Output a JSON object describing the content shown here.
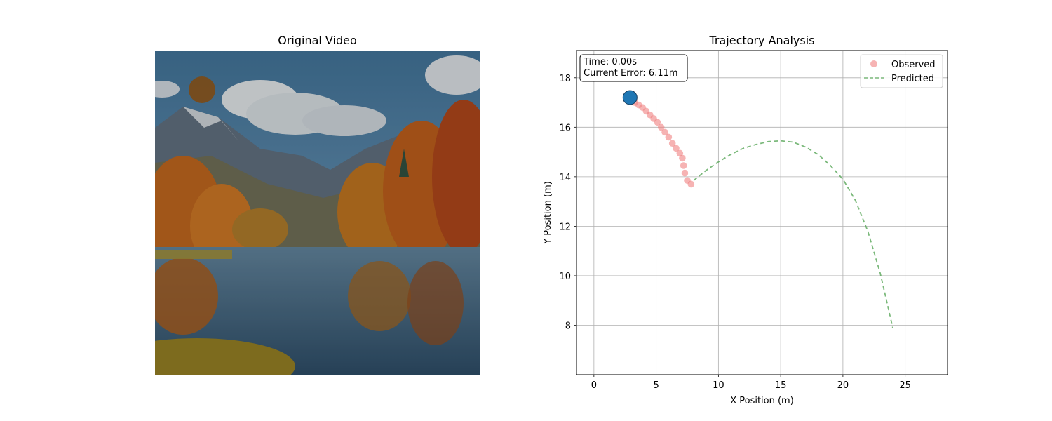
{
  "left_panel": {
    "title": "Original Video",
    "ball_color": "#7a4a17"
  },
  "chart_data": {
    "type": "scatter",
    "title": "Trajectory Analysis",
    "xlabel": "X Position (m)",
    "ylabel": "Y Position (m)",
    "xlim": [
      -1.4,
      28.4
    ],
    "ylim": [
      6.0,
      19.1
    ],
    "xticks": [
      0,
      5,
      10,
      15,
      20,
      25
    ],
    "yticks": [
      8,
      10,
      12,
      14,
      16,
      18
    ],
    "grid": true,
    "legend_position": "top-right",
    "annotation": {
      "time_text": "Time: 0.00s",
      "error_text": "Current Error: 6.11m"
    },
    "current_position": {
      "x": 2.9,
      "y": 17.2,
      "color": "#1f77b4"
    },
    "series": [
      {
        "name": "Observed",
        "style": "markers",
        "color": "#f08080",
        "x": [
          3.0,
          3.3,
          3.6,
          3.9,
          4.2,
          4.5,
          4.8,
          5.1,
          5.4,
          5.7,
          6.0,
          6.3,
          6.6,
          6.9,
          7.1,
          7.2,
          7.3,
          7.5,
          7.8
        ],
        "y": [
          17.1,
          17.0,
          16.9,
          16.8,
          16.65,
          16.5,
          16.35,
          16.2,
          16.0,
          15.8,
          15.6,
          15.35,
          15.15,
          14.95,
          14.75,
          14.45,
          14.15,
          13.85,
          13.7
        ]
      },
      {
        "name": "Predicted",
        "style": "dashed",
        "color": "#5aa85a",
        "x": [
          8.0,
          9.0,
          10.0,
          11.0,
          12.0,
          13.0,
          14.0,
          15.0,
          16.0,
          17.0,
          18.0,
          19.0,
          20.0,
          21.0,
          22.0,
          23.0,
          24.0
        ],
        "y": [
          13.85,
          14.25,
          14.6,
          14.9,
          15.15,
          15.3,
          15.42,
          15.45,
          15.4,
          15.2,
          14.9,
          14.45,
          13.9,
          13.05,
          11.8,
          10.1,
          7.9
        ]
      }
    ]
  }
}
